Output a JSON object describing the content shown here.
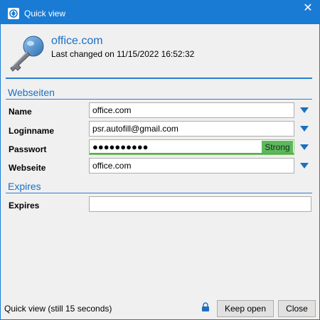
{
  "window": {
    "title": "Quick view",
    "close_glyph": "✕"
  },
  "entry": {
    "name": "office.com",
    "last_changed": "Last changed on 11/15/2022 16:52:32",
    "icon": "key-icon"
  },
  "sections": {
    "webseiten": "Webseiten",
    "expires": "Expires"
  },
  "fields": {
    "name_label": "Name",
    "name_value": "office.com",
    "login_label": "Loginname",
    "login_value": "psr.autofill@gmail.com",
    "password_label": "Passwort",
    "password_masked": "●●●●●●●●●●",
    "password_strength": "Strong",
    "password_strength_level": 1.0,
    "website_label": "Webseite",
    "website_value": "office.com",
    "expires_label": "Expires",
    "expires_value": ""
  },
  "footer": {
    "status": "Quick view (still 15 seconds)",
    "lock_icon": "lock-icon",
    "keep_open": "Keep open",
    "close": "Close"
  },
  "colors": {
    "accent": "#1a7bd4",
    "heading": "#1b6fc2",
    "strength": "#5cb85c",
    "arrow": "#1b6fc2"
  }
}
